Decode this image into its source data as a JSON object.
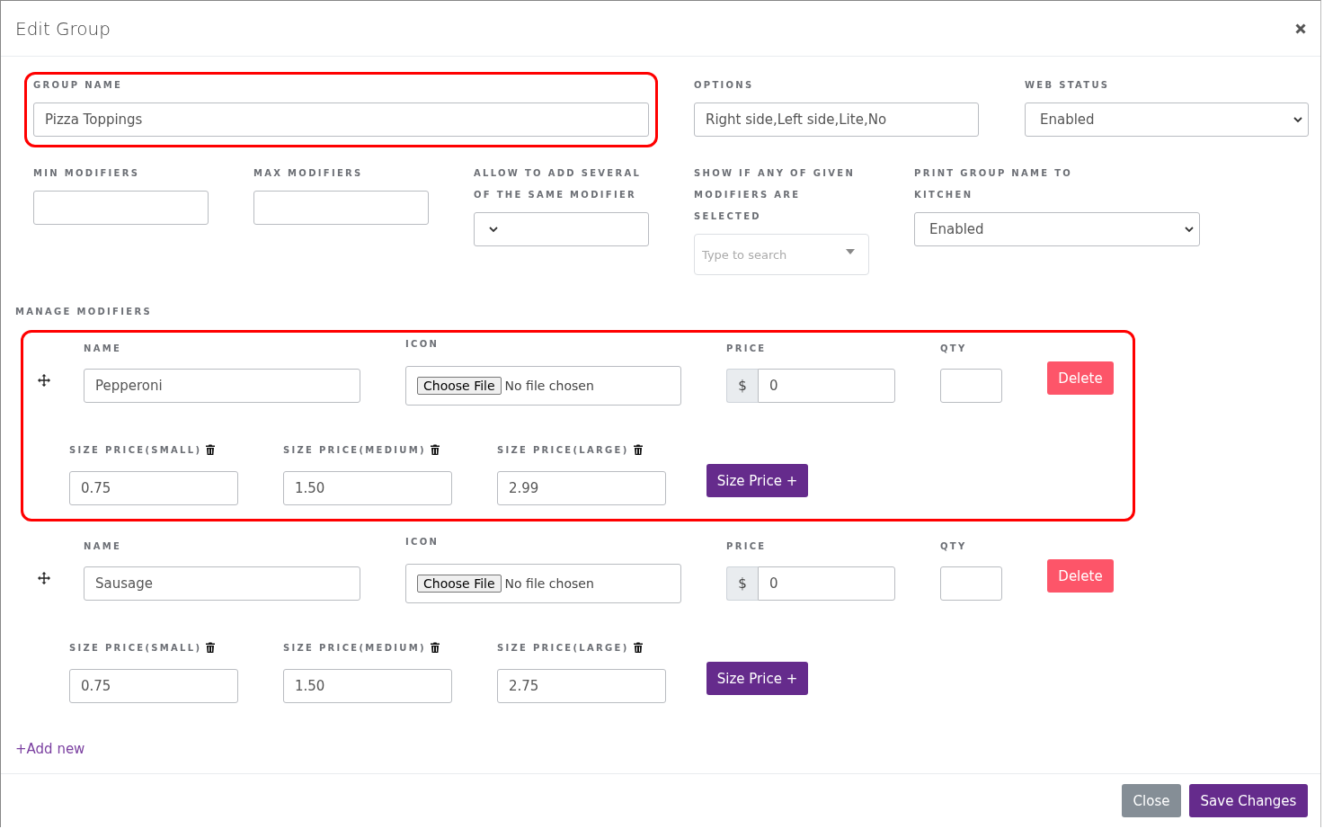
{
  "dialog": {
    "title": "Edit Group"
  },
  "group_name": {
    "label": "GROUP NAME",
    "value": "Pizza Toppings",
    "highlighted": true
  },
  "options": {
    "label": "OPTIONS",
    "value": "Right side,Left side,Lite,No"
  },
  "web_status": {
    "label": "WEB STATUS",
    "value": "Enabled"
  },
  "min_modifiers": {
    "label": "MIN MODIFIERS"
  },
  "max_modifiers": {
    "label": "MAX MODIFIERS"
  },
  "allow_several": {
    "label": "ALLOW TO ADD SEVERAL OF THE SAME MODIFIER"
  },
  "show_if_selected": {
    "label": "SHOW IF ANY OF GIVEN MODIFIERS ARE SELECTED",
    "placeholder": "Type to search"
  },
  "print_group_name": {
    "label": "PRINT GROUP NAME TO KITCHEN",
    "value": "Enabled"
  },
  "manage_modifiers": {
    "heading": "MANAGE MODIFIERS",
    "modifiers": [
      {
        "highlighted": true,
        "name_label": "NAME",
        "name": "Pepperoni",
        "icon_label": "ICON",
        "file_button": "Choose File",
        "file_status": "No file chosen",
        "price_label": "PRICE",
        "currency": "$",
        "price": "0",
        "qty_label": "QTY",
        "delete_label": "Delete",
        "size_prices": [
          {
            "label": "SIZE PRICE(SMALL)",
            "value": "0.75"
          },
          {
            "label": "SIZE PRICE(MEDIUM)",
            "value": "1.50"
          },
          {
            "label": "SIZE PRICE(LARGE)",
            "value": "2.99"
          }
        ],
        "size_price_button": "Size Price +"
      },
      {
        "highlighted": false,
        "name_label": "NAME",
        "name": "Sausage",
        "icon_label": "ICON",
        "file_button": "Choose File",
        "file_status": "No file chosen",
        "price_label": "PRICE",
        "currency": "$",
        "price": "0",
        "qty_label": "QTY",
        "delete_label": "Delete",
        "size_prices": [
          {
            "label": "SIZE PRICE(SMALL)",
            "value": "0.75"
          },
          {
            "label": "SIZE PRICE(MEDIUM)",
            "value": "1.50"
          },
          {
            "label": "SIZE PRICE(LARGE)",
            "value": "2.75"
          }
        ],
        "size_price_button": "Size Price +"
      }
    ]
  },
  "add_new": "+Add new",
  "footer": {
    "buttons": [
      {
        "kind": "secondary",
        "label": "Close"
      },
      {
        "kind": "primary",
        "label": "Save Changes"
      }
    ]
  }
}
